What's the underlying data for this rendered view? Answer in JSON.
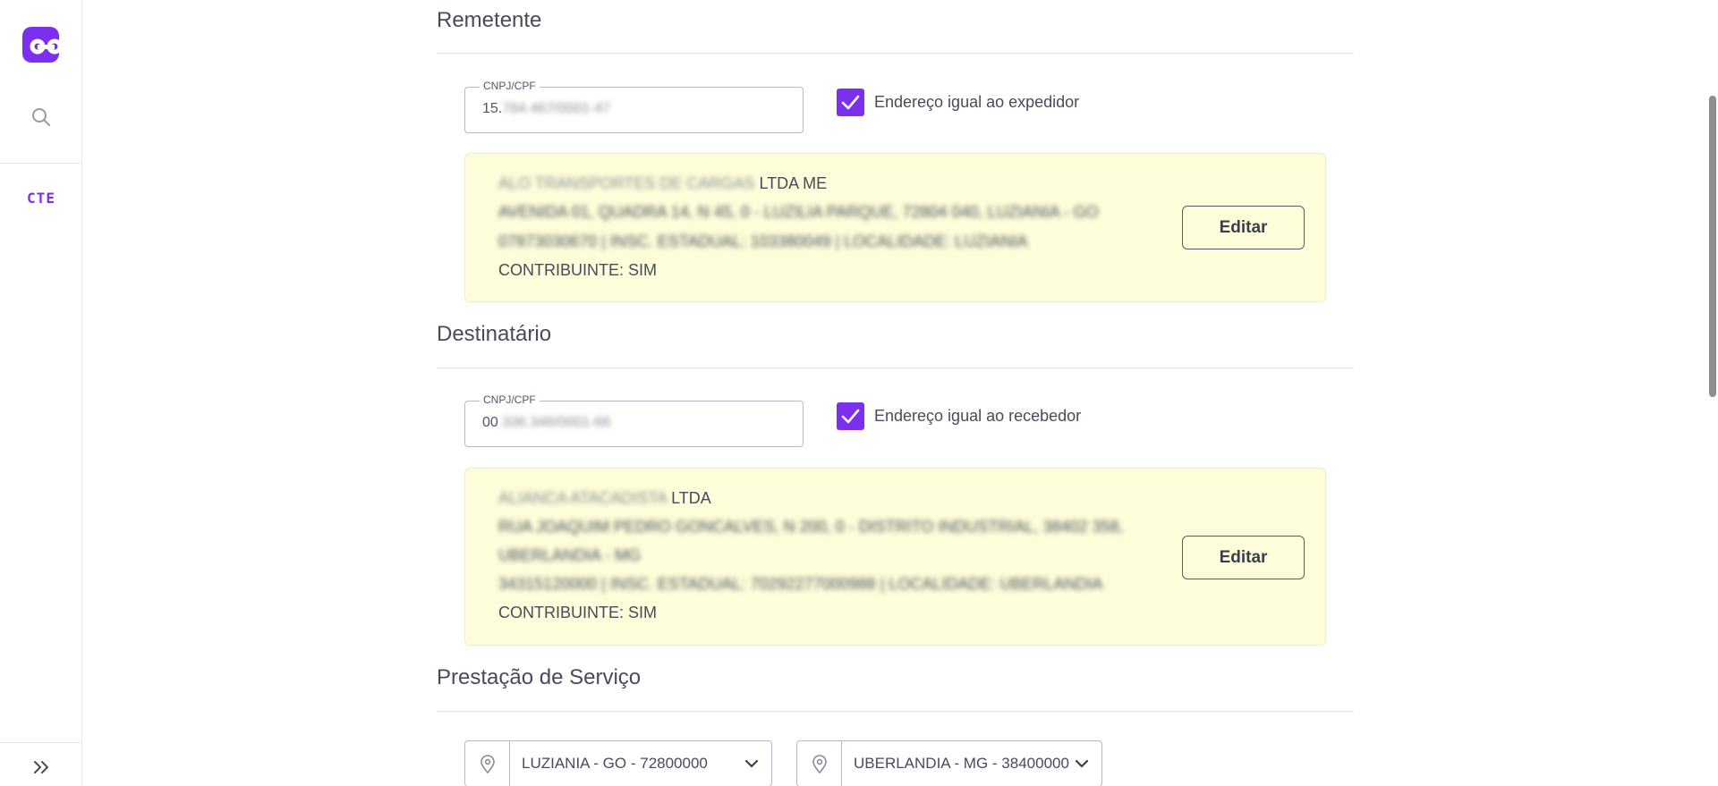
{
  "sidebar": {
    "logo_icon": "logo-icon",
    "search_icon": "search-icon",
    "nav_item": "CTE",
    "expand_icon": "double-chevron-right-icon"
  },
  "remetente": {
    "title": "Remetente",
    "cnpj_label": "CNPJ/CPF",
    "cnpj_prefix": "15.",
    "cnpj_blurred": "784.467/0001-47",
    "checkbox_label": "Endereço igual ao expedidor",
    "card": {
      "name_blurred": "ALO TRANSPORTES DE CARGAS",
      "name_suffix": "LTDA ME",
      "address_blurred": "AVENIDA 01, QUADRA 14, N 45, 0 - LUZILIA PARQUE, 72804 040, LUZIANIA - GO",
      "ids_blurred": "07873030670 | INSC. ESTADUAL: 103380049 | LOCALIDADE: LUZIANIA",
      "contribuinte": "CONTRIBUINTE: SIM"
    },
    "edit_label": "Editar"
  },
  "destinatario": {
    "title": "Destinatário",
    "cnpj_label": "CNPJ/CPF",
    "cnpj_prefix": "00",
    "cnpj_blurred": ".336.346/0001-66",
    "checkbox_label": "Endereço igual ao recebedor",
    "card": {
      "name_blurred": "ALIANCA ATACADISTA",
      "name_suffix": "LTDA",
      "address_blurred_1": "RUA JOAQUIM PEDRO GONCALVES, N 200, 0 - DISTRITO INDUSTRIAL, 38402 358,",
      "address_blurred_2": "UBERLANDIA - MG",
      "ids_blurred": "34315120000 | INSC. ESTADUAL: 70292277000988 | LOCALIDADE: UBERLANDIA",
      "contribuinte": "CONTRIBUINTE: SIM"
    },
    "edit_label": "Editar"
  },
  "prestacao": {
    "title": "Prestação de Serviço",
    "origem": "LUZIANIA - GO - 72800000",
    "destino": "UBERLANDIA - MG - 38400000"
  },
  "colors": {
    "accent": "#7d2ff0",
    "card_bg": "#fefdd9"
  }
}
